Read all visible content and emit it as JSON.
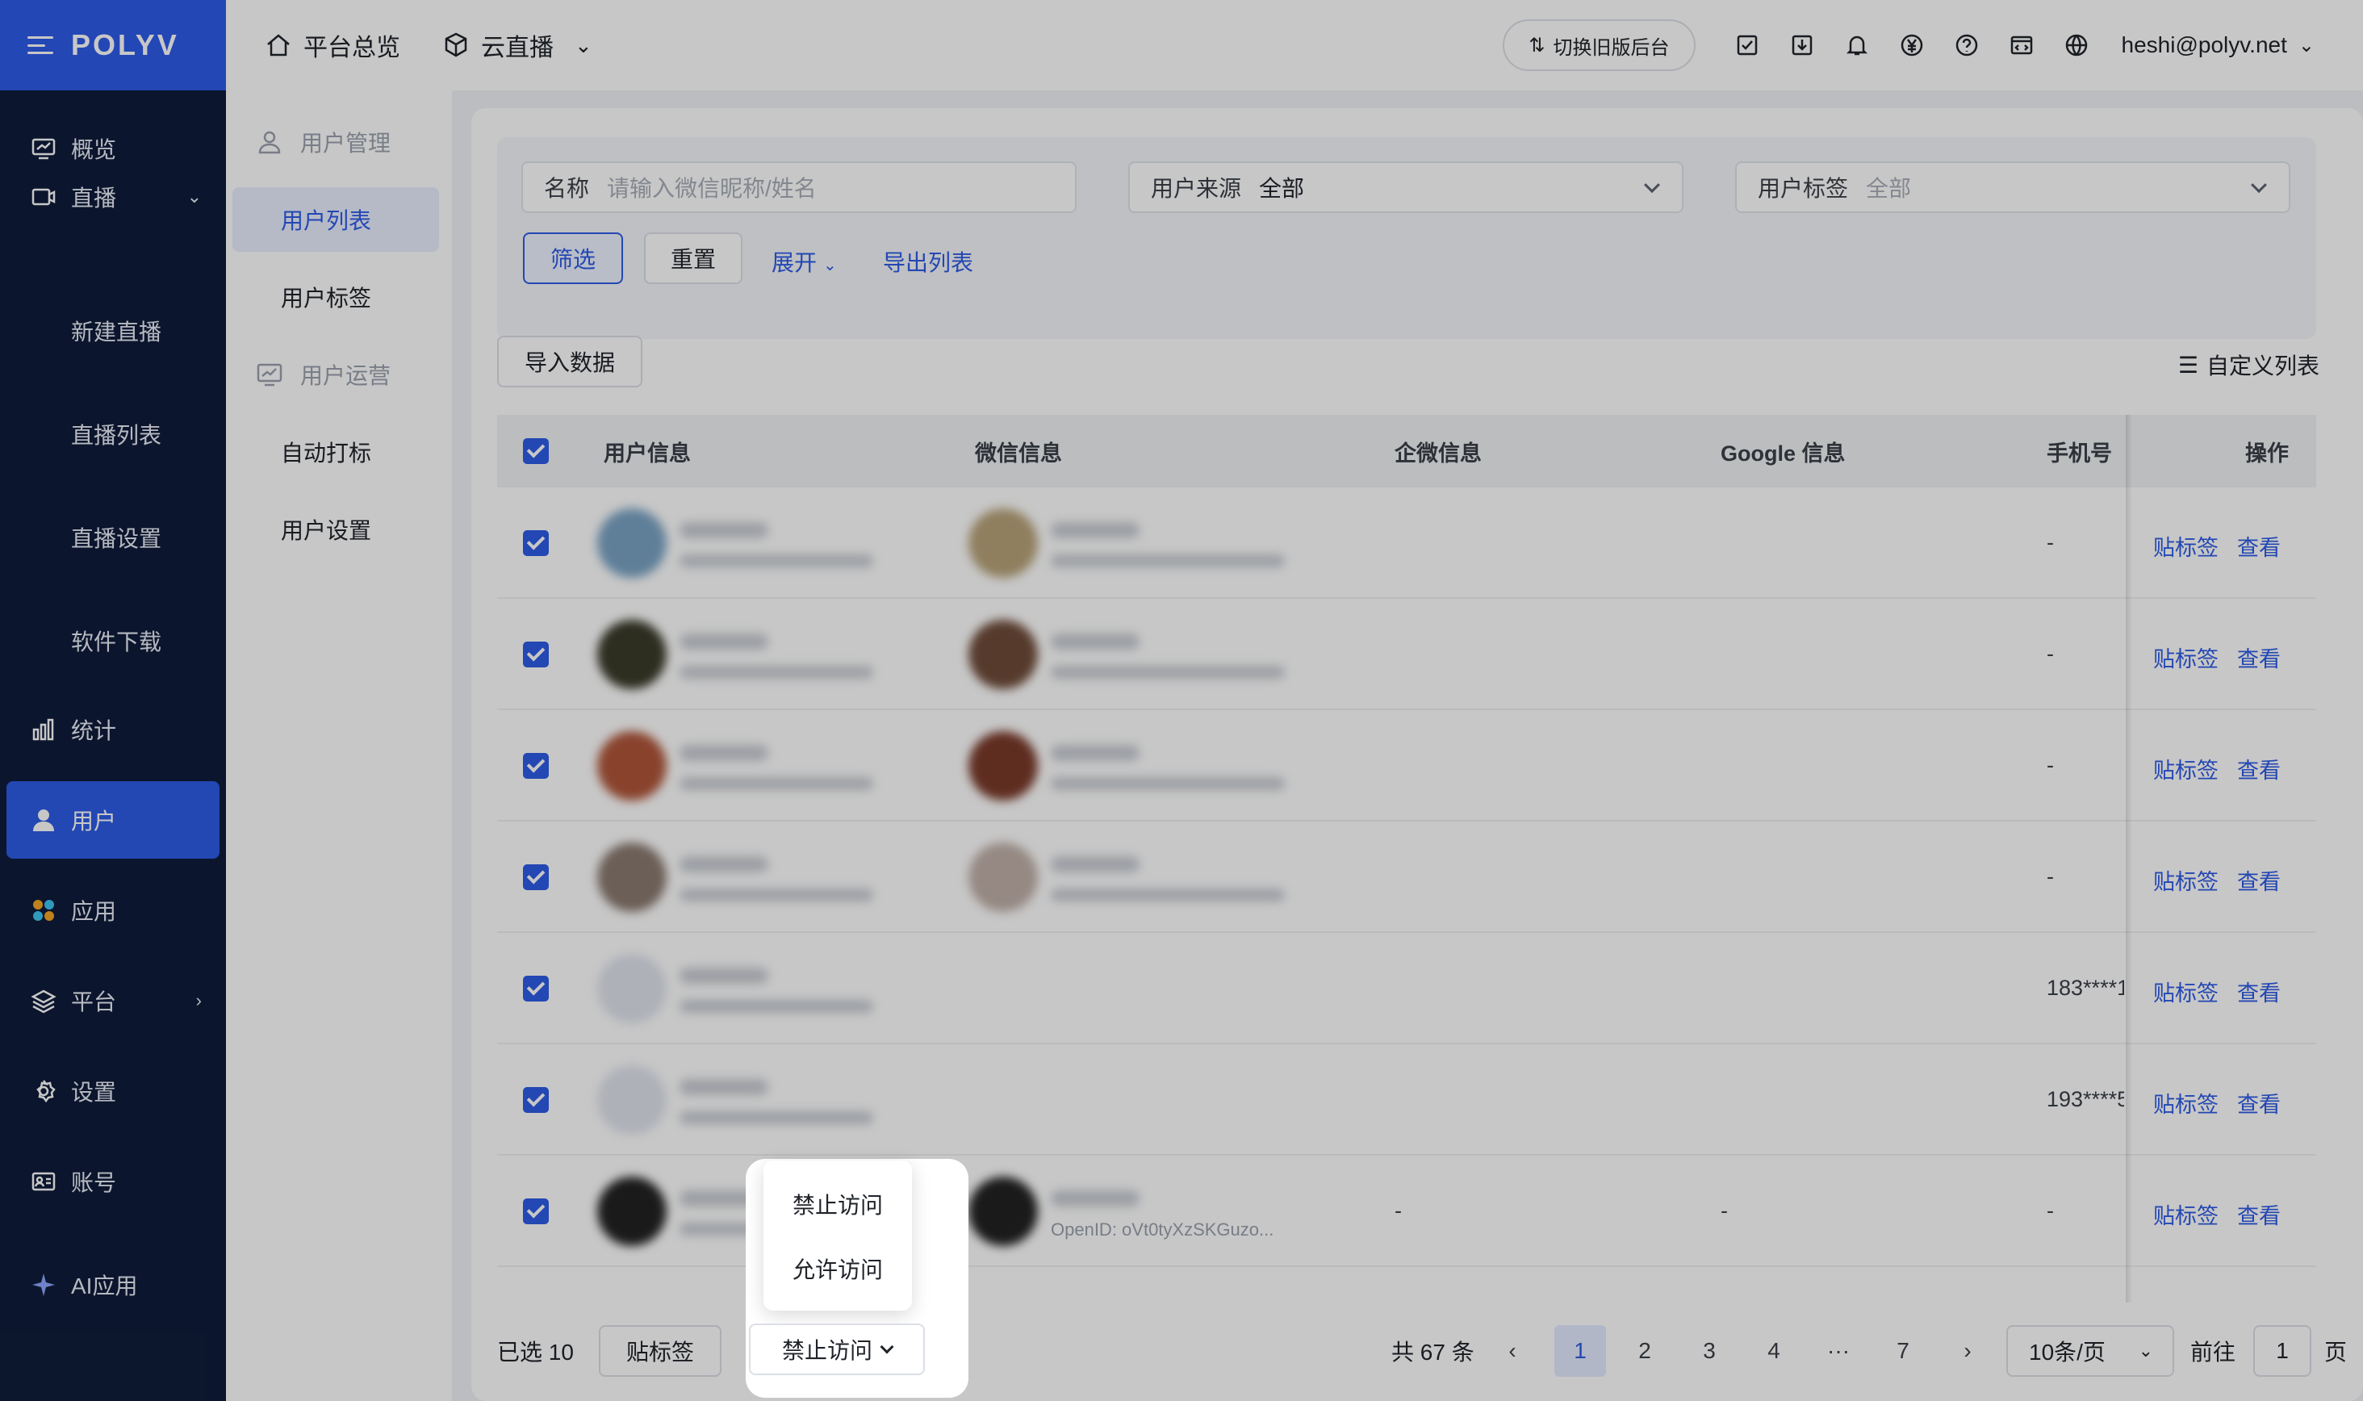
{
  "brand": {
    "logo": "POLYV"
  },
  "nav": {
    "items": [
      {
        "label": "概览",
        "icon": "overview-icon"
      },
      {
        "label": "直播",
        "icon": "live-icon"
      },
      {
        "label": "统计",
        "icon": "stats-icon"
      },
      {
        "label": "用户",
        "icon": "user-icon"
      },
      {
        "label": "应用",
        "icon": "apps-icon"
      },
      {
        "label": "平台",
        "icon": "platform-icon"
      },
      {
        "label": "设置",
        "icon": "settings-icon"
      },
      {
        "label": "账号",
        "icon": "account-icon"
      },
      {
        "label": "AI应用",
        "icon": "ai-sparkle-icon"
      }
    ],
    "live_sub": [
      "新建直播",
      "直播列表",
      "直播设置",
      "软件下载"
    ]
  },
  "header": {
    "home": "平台总览",
    "product": "云直播",
    "switch_label": "切换旧版后台",
    "email": "heshi@polyv.net"
  },
  "submenu": {
    "group1": "用户管理",
    "item_list": "用户列表",
    "item_tags": "用户标签",
    "group2": "用户运营",
    "item_auto": "自动打标",
    "item_settings": "用户设置"
  },
  "filters": {
    "name_label": "名称",
    "name_placeholder": "请输入微信昵称/姓名",
    "source_label": "用户来源",
    "source_value": "全部",
    "tag_label": "用户标签",
    "tag_value": "全部",
    "filter_btn": "筛选",
    "reset_btn": "重置",
    "expand_link": "展开",
    "export_link": "导出列表"
  },
  "toolbar": {
    "import_btn": "导入数据",
    "customize": "自定义列表"
  },
  "table": {
    "headers": [
      "用户信息",
      "微信信息",
      "企微信息",
      "Google 信息",
      "手机号",
      "操作"
    ],
    "rows": [
      {
        "phone": "-",
        "tag": "贴标签",
        "view": "查看"
      },
      {
        "phone": "-",
        "tag": "贴标签",
        "view": "查看"
      },
      {
        "phone": "-",
        "tag": "贴标签",
        "view": "查看"
      },
      {
        "phone": "-",
        "tag": "贴标签",
        "view": "查看"
      },
      {
        "phone": "183****1",
        "tag": "贴标签",
        "view": "查看"
      },
      {
        "phone": "193****5",
        "tag": "贴标签",
        "view": "查看"
      },
      {
        "phone": "-",
        "qw": "-",
        "google": "-",
        "wx_openid": "OpenID: oVt0tyXzSKGuzo...",
        "tag": "贴标签",
        "view": "查看"
      }
    ]
  },
  "bottom": {
    "selected": "已选 10",
    "tag_btn": "贴标签",
    "ban_btn": "禁止访问",
    "total": "共 67 条",
    "pages": [
      "1",
      "2",
      "3",
      "4",
      "···",
      "7"
    ],
    "page_size": "10条/页",
    "goto": "前往",
    "goto_value": "1",
    "page_unit": "页"
  },
  "dropdown": {
    "options": [
      "禁止访问",
      "允许访问"
    ]
  },
  "colors": {
    "primary": "#2e5be6",
    "nav_bg": "#0f1c3a"
  }
}
